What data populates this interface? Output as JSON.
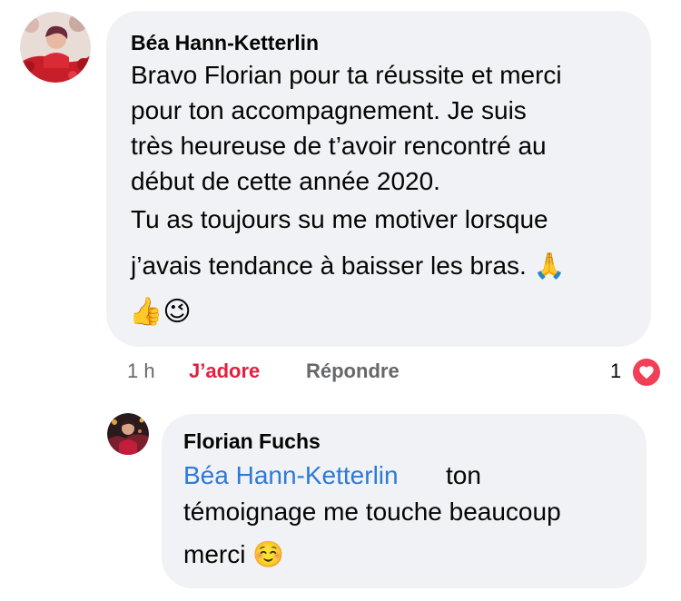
{
  "comment": {
    "author": "Béa Hann-Ketterlin",
    "lines": [
      "Bravo Florian pour ta réussite et merci",
      "pour ton accompagnement. Je suis",
      "très heureuse de t’avoir rencontré au",
      "début de cette année 2020.",
      "Tu as toujours su me motiver lorsque",
      "j’avais tendance à baisser les bras. 🙏"
    ],
    "emojis": "👍😉",
    "time": "1 h",
    "like_label": "J’adore",
    "reply_label": "Répondre",
    "reaction_count": "1",
    "reaction_icon": "heart-icon"
  },
  "reply": {
    "author": "Florian Fuchs",
    "mention": "Béa Hann-Ketterlin",
    "line1_rest": "ton",
    "line2": "témoignage me touche beaucoup",
    "line3": "merci ☺️"
  },
  "colors": {
    "bubble": "#f0f2f5",
    "mention": "#2d7ad6",
    "like_active": "#e41e3f",
    "heart": "#f33e58",
    "meta_gray": "#65676b"
  }
}
